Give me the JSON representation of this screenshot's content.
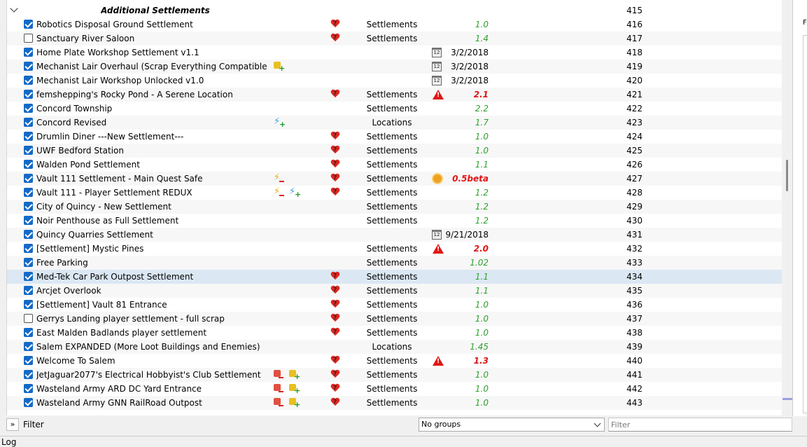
{
  "group": {
    "label": "Additional Settlements",
    "priority": "415"
  },
  "mods": [
    {
      "name": "Robotics Disposal Ground Settlement",
      "checked": true,
      "icons": [],
      "heart": true,
      "category": "Settlements",
      "flag": "",
      "version": "1.0",
      "vstyle": "green",
      "priority": "416"
    },
    {
      "name": "Sanctuary River Saloon",
      "checked": false,
      "icons": [],
      "heart": true,
      "category": "Settlements",
      "flag": "",
      "version": "1.4",
      "vstyle": "green",
      "priority": "417"
    },
    {
      "name": "Home Plate Workshop Settlement v1.1",
      "checked": true,
      "icons": [],
      "heart": false,
      "category": "",
      "flag": "calendar",
      "version": "3/2/2018",
      "vstyle": "date",
      "priority": "418"
    },
    {
      "name": "Mechanist Lair Overhaul (Scrap Everything Compatible)",
      "checked": true,
      "icons": [
        "yellow-plus"
      ],
      "heart": false,
      "category": "",
      "flag": "calendar",
      "version": "3/2/2018",
      "vstyle": "date",
      "priority": "419"
    },
    {
      "name": "Mechanist Lair Workshop Unlocked v1.0",
      "checked": true,
      "icons": [],
      "heart": false,
      "category": "",
      "flag": "calendar",
      "version": "3/2/2018",
      "vstyle": "date",
      "priority": "420"
    },
    {
      "name": "femshepping's Rocky Pond - A Serene Location",
      "checked": true,
      "icons": [],
      "heart": true,
      "category": "Settlements",
      "flag": "warning",
      "version": "2.1",
      "vstyle": "red",
      "priority": "421"
    },
    {
      "name": "Concord Township",
      "checked": true,
      "icons": [],
      "heart": false,
      "category": "Settlements",
      "flag": "",
      "version": "2.2",
      "vstyle": "green",
      "priority": "422"
    },
    {
      "name": "Concord Revised",
      "checked": true,
      "icons": [
        "bolt-plus"
      ],
      "heart": false,
      "category": "Locations",
      "flag": "",
      "version": "1.7",
      "vstyle": "green",
      "priority": "423"
    },
    {
      "name": "Drumlin Diner ---New Settlement---",
      "checked": true,
      "icons": [],
      "heart": true,
      "category": "Settlements",
      "flag": "",
      "version": "1.0",
      "vstyle": "green",
      "priority": "424"
    },
    {
      "name": "UWF Bedford Station",
      "checked": true,
      "icons": [],
      "heart": true,
      "category": "Settlements",
      "flag": "",
      "version": "1.0",
      "vstyle": "green",
      "priority": "425"
    },
    {
      "name": "Walden Pond Settlement",
      "checked": true,
      "icons": [],
      "heart": true,
      "category": "Settlements",
      "flag": "",
      "version": "1.1",
      "vstyle": "green",
      "priority": "426"
    },
    {
      "name": "Vault 111 Settlement - Main Quest Safe",
      "checked": true,
      "icons": [
        "bolt-minus"
      ],
      "heart": true,
      "category": "Settlements",
      "flag": "sun",
      "version": "0.5beta",
      "vstyle": "red",
      "priority": "427"
    },
    {
      "name": "Vault 111 - Player Settlement REDUX",
      "checked": true,
      "icons": [
        "bolt-minus",
        "bolt-plus"
      ],
      "heart": true,
      "category": "Settlements",
      "flag": "",
      "version": "1.2",
      "vstyle": "green",
      "priority": "428"
    },
    {
      "name": "City of Quincy - New Settlement",
      "checked": true,
      "icons": [],
      "heart": false,
      "category": "Settlements",
      "flag": "",
      "version": "1.2",
      "vstyle": "green",
      "priority": "429"
    },
    {
      "name": "Noir Penthouse as Full Settlement",
      "checked": true,
      "icons": [],
      "heart": false,
      "category": "Settlements",
      "flag": "",
      "version": "1.2",
      "vstyle": "green",
      "priority": "430"
    },
    {
      "name": "Quincy Quarries Settlement",
      "checked": true,
      "icons": [],
      "heart": false,
      "category": "",
      "flag": "calendar",
      "version": "9/21/2018",
      "vstyle": "date",
      "priority": "431"
    },
    {
      "name": "[Settlement] Mystic Pines",
      "checked": true,
      "icons": [],
      "heart": false,
      "category": "Settlements",
      "flag": "warning",
      "version": "2.0",
      "vstyle": "red",
      "priority": "432"
    },
    {
      "name": "Free Parking",
      "checked": true,
      "icons": [],
      "heart": false,
      "category": "Settlements",
      "flag": "",
      "version": "1.02",
      "vstyle": "green",
      "priority": "433"
    },
    {
      "name": "Med-Tek Car Park Outpost Settlement",
      "checked": true,
      "icons": [],
      "heart": true,
      "category": "Settlements",
      "flag": "",
      "version": "1.1",
      "vstyle": "green",
      "priority": "434",
      "selected": true
    },
    {
      "name": "Arcjet Overlook",
      "checked": true,
      "icons": [],
      "heart": true,
      "category": "Settlements",
      "flag": "",
      "version": "1.1",
      "vstyle": "green",
      "priority": "435"
    },
    {
      "name": "[Settlement] Vault 81 Entrance",
      "checked": true,
      "icons": [],
      "heart": true,
      "category": "Settlements",
      "flag": "",
      "version": "1.0",
      "vstyle": "green",
      "priority": "436"
    },
    {
      "name": "Gerrys Landing player settlement - full scrap",
      "checked": false,
      "icons": [],
      "heart": true,
      "category": "Settlements",
      "flag": "",
      "version": "1.0",
      "vstyle": "green",
      "priority": "437"
    },
    {
      "name": "East Malden Badlands player settlement",
      "checked": true,
      "icons": [],
      "heart": true,
      "category": "Settlements",
      "flag": "",
      "version": "1.0",
      "vstyle": "green",
      "priority": "438"
    },
    {
      "name": "Salem EXPANDED (More Loot Buildings and Enemies)",
      "checked": true,
      "icons": [],
      "heart": false,
      "category": "Locations",
      "flag": "",
      "version": "1.45",
      "vstyle": "green",
      "priority": "439"
    },
    {
      "name": "Welcome To Salem",
      "checked": true,
      "icons": [],
      "heart": true,
      "category": "Settlements",
      "flag": "warning",
      "version": "1.3",
      "vstyle": "red",
      "priority": "440"
    },
    {
      "name": "JetJaguar2077's Electrical Hobbyist's Club Settlement",
      "checked": true,
      "icons": [
        "red-minus",
        "yellow-plus"
      ],
      "heart": true,
      "category": "Settlements",
      "flag": "",
      "version": "1.0",
      "vstyle": "green",
      "priority": "441"
    },
    {
      "name": "Wasteland Army ARD DC Yard Entrance",
      "checked": true,
      "icons": [
        "red-minus",
        "yellow-plus"
      ],
      "heart": true,
      "category": "Settlements",
      "flag": "",
      "version": "1.0",
      "vstyle": "green",
      "priority": "442"
    },
    {
      "name": "Wasteland Army GNN RailRoad Outpost",
      "checked": true,
      "icons": [
        "red-minus",
        "yellow-plus"
      ],
      "heart": true,
      "category": "Settlements",
      "flag": "",
      "version": "1.0",
      "vstyle": "green",
      "priority": "443"
    }
  ],
  "footer": {
    "expand_label": "»",
    "filter_label": "Filter",
    "groups_value": "No groups",
    "filter_placeholder": "Filter"
  },
  "log": {
    "label": "Log"
  },
  "right_pane": {
    "label": "F"
  }
}
